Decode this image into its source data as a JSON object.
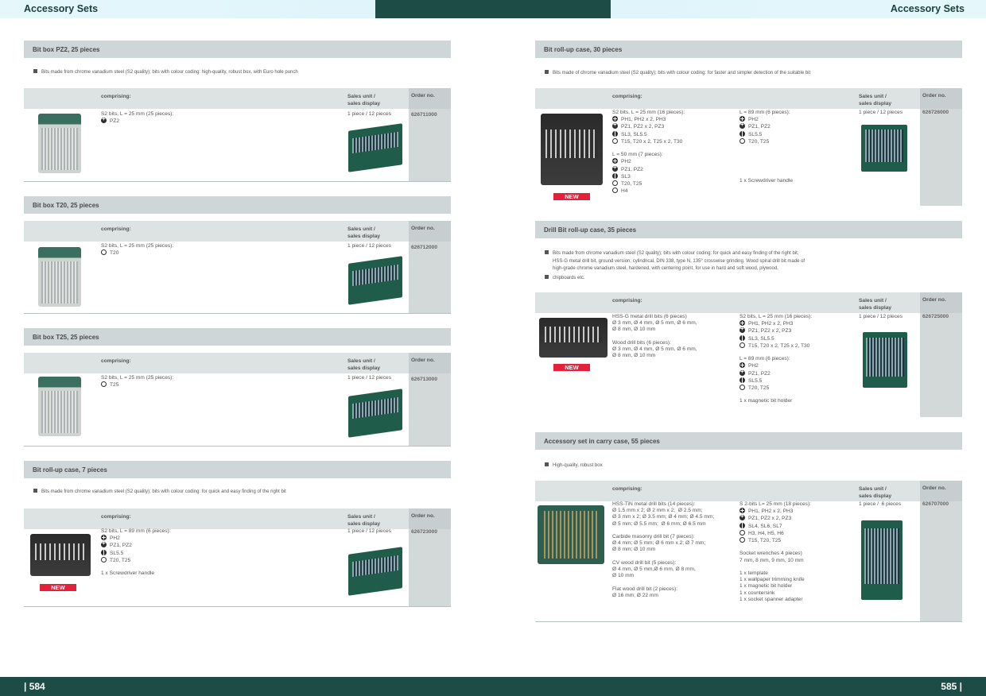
{
  "header": {
    "title_left": "Accessory Sets",
    "title_right": "Accessory Sets"
  },
  "footer": {
    "page_left": "| 584",
    "page_right": "585 |"
  },
  "table_labels": {
    "comprising": "comprising:",
    "sales_unit_1": "Sales unit /",
    "sales_unit_2": "sales display",
    "order_no": "Order no."
  },
  "new_label": "NEW",
  "sections": {
    "pz2": {
      "title": "Bit box PZ2, 25 pieces",
      "bullet": "Bits made from chrome vanadium steel (S2 quality); bits with colour coding: high-quality, robust box, with Euro hole punch",
      "col1": [
        {
          "t": "S2 bits, L = 25 mm (25 pieces):"
        },
        {
          "s": "pz",
          "t": "PZ2"
        }
      ],
      "sales": "1 piece / 12 pieces",
      "order": "626711000"
    },
    "t20": {
      "title": "Bit box T20, 25 pieces",
      "col1": [
        {
          "t": "S2 bits, L = 25 mm (25 pieces):"
        },
        {
          "s": "tx",
          "t": "T20"
        }
      ],
      "sales": "1 piece / 12 pieces",
      "order": "626712000"
    },
    "t25": {
      "title": "Bit box T25, 25 pieces",
      "col1": [
        {
          "t": "S2 bits, L = 25 mm (25 pieces):"
        },
        {
          "s": "tx",
          "t": "T25"
        }
      ],
      "sales": "1 piece / 12 pieces",
      "order": "626713000"
    },
    "roll7": {
      "title": "Bit roll-up case, 7 pieces",
      "bullet": "Bits made from chrome vanadium steel (S2 quality); bits with colour coding: for quick and easy finding of the right bit",
      "col1": [
        {
          "t": "S2 bits, L = 89 mm (6 pieces):"
        },
        {
          "s": "ph",
          "t": "PH2"
        },
        {
          "s": "pz",
          "t": "PZ1, PZ2"
        },
        {
          "s": "sl",
          "t": "SL5.5"
        },
        {
          "s": "tx",
          "t": "T20, T25"
        },
        {
          "t": ""
        },
        {
          "t": "1 x Screwdriver handle"
        }
      ],
      "sales": "1 piece / 12 pieces",
      "order": "626723000"
    },
    "roll30": {
      "title": "Bit roll-up case, 30 pieces",
      "bullet": "Bits made of chrome vanadium steel (S2 quality); bits with colour coding: for faster and simpler detection of the suitable bit",
      "col1": [
        {
          "t": "S2 bits, L = 25 mm (16 pieces):"
        },
        {
          "s": "ph",
          "t": "PH1, PH2 x 2, PH3"
        },
        {
          "s": "pz",
          "t": "PZ1, PZ2 x 2, PZ3"
        },
        {
          "s": "sl",
          "t": "SL3, SL5.5"
        },
        {
          "s": "tx",
          "t": "T15, T20 x 2, T25 x 2, T30"
        },
        {
          "t": ""
        },
        {
          "t": "L = 50 mm (7 pieces):"
        },
        {
          "s": "ph",
          "t": "PH2"
        },
        {
          "s": "pz",
          "t": "PZ1, PZ2"
        },
        {
          "s": "sl",
          "t": "SL3"
        },
        {
          "s": "tx",
          "t": "T20, T25"
        },
        {
          "s": "tx",
          "t": "H4"
        }
      ],
      "col2": [
        {
          "t": "L = 89 mm (6 pieces):"
        },
        {
          "s": "ph",
          "t": "PH2"
        },
        {
          "s": "pz",
          "t": "PZ1, PZ2"
        },
        {
          "s": "sl",
          "t": "SL5.5"
        },
        {
          "s": "tx",
          "t": "T20, T25"
        },
        {
          "t": ""
        },
        {
          "t": ""
        },
        {
          "t": ""
        },
        {
          "t": ""
        },
        {
          "t": ""
        },
        {
          "t": "1 x Screwdriver handle"
        }
      ],
      "sales": "1 piece / 12 pieces",
      "order": "626726000"
    },
    "drill35": {
      "title": "Drill Bit roll-up case, 35 pieces",
      "bullet_lines": [
        "Bits made from chrome vanadium steel (S2 quality); bits with colour coding: for quick and easy finding of the right bit;",
        "HSS-G metal drill bit, ground version, cylindrical, DIN 338, type N, 135° crosswise grinding. Wood spiral drill bit made of",
        "high-grade chrome vanadium steel, hardened, with centering point, for use in hard and soft wood, plywood,"
      ],
      "bullet2": "chipboards etc.",
      "col1": [
        {
          "t": "HSS-G metal drill bits (6 pieces)"
        },
        {
          "t": "Ø 3 mm, Ø 4 mm, Ø 5 mm, Ø 6 mm,"
        },
        {
          "t": "Ø 8 mm, Ø 10 mm"
        },
        {
          "t": ""
        },
        {
          "t": "Wood drill bits (6 pieces):"
        },
        {
          "t": "Ø 3 mm, Ø 4 mm, Ø 5 mm, Ø 6 mm,"
        },
        {
          "t": "Ø 8 mm, Ø 10 mm"
        }
      ],
      "col2": [
        {
          "t": "S2 bits, L = 25 mm (16 pieces):"
        },
        {
          "s": "ph",
          "t": "PH1, PH2 x 2, PH3"
        },
        {
          "s": "pz",
          "t": "PZ1, PZ2 x 2, PZ3"
        },
        {
          "s": "sl",
          "t": "SL3, SL5.5"
        },
        {
          "s": "tx",
          "t": "T15, T20 x 2, T25 x 2, T30"
        },
        {
          "t": ""
        },
        {
          "t": "L = 89 mm (6 pieces):"
        },
        {
          "s": "ph",
          "t": "PH2"
        },
        {
          "s": "pz",
          "t": "PZ1, PZ2"
        },
        {
          "s": "sl",
          "t": "SL5.5"
        },
        {
          "s": "tx",
          "t": "T20, T25"
        },
        {
          "t": ""
        },
        {
          "t": "1 x magnetic bit holder"
        }
      ],
      "sales": "1 piece / 12 pieces",
      "order": "626725000"
    },
    "carry55": {
      "title": "Accessory set in carry case, 55 pieces",
      "bullet": "High-quality, robust box",
      "col1": [
        {
          "t": "HSS-TiN metal drill bits (14 pieces):"
        },
        {
          "t": "Ø 1.5 mm x 2; Ø 2 mm x 2;  Ø 2.5 mm;"
        },
        {
          "t": "Ø 3 mm x 2; Ø 3.5 mm; Ø 4 mm; Ø 4.5 mm;"
        },
        {
          "t": "Ø 5 mm; Ø 5.5 mm;  Ø 6 mm; Ø 6.5 mm"
        },
        {
          "t": ""
        },
        {
          "t": "Carbide masonry drill bit (7 pieces):"
        },
        {
          "t": "Ø 4 mm; Ø 5 mm; Ø 6 mm x 2; Ø 7 mm;"
        },
        {
          "t": "Ø 8 mm; Ø 10 mm"
        },
        {
          "t": ""
        },
        {
          "t": "CV wood drill bit (5 pieces):"
        },
        {
          "t": "Ø 4 mm, Ø 5 mm,Ø 6 mm, Ø 8 mm,"
        },
        {
          "t": "Ø 10 mm"
        },
        {
          "t": ""
        },
        {
          "t": "Flat wood drill bit (2 pieces):"
        },
        {
          "t": "Ø 16 mm; Ø 22 mm"
        }
      ],
      "col2": [
        {
          "t": "S 2-bits L= 25 mm (18 pieces):"
        },
        {
          "s": "ph",
          "t": "PH1, PH2 x 2, PH3"
        },
        {
          "s": "pz",
          "t": "PZ1, PZ2 x 2, PZ3"
        },
        {
          "s": "sl",
          "t": "SL4, SL6, SL7"
        },
        {
          "s": "tx",
          "t": "H3, H4, H5, H6"
        },
        {
          "s": "tx",
          "t": "T15, T20, T25"
        },
        {
          "t": ""
        },
        {
          "t": "Socket wrenches 4 pieces)"
        },
        {
          "t": "7 mm, 8 mm, 9 mm, 10 mm"
        },
        {
          "t": ""
        },
        {
          "t": "1 x template"
        },
        {
          "t": "1 x wallpaper trimming knife"
        },
        {
          "t": "1 x magnetic bit holder"
        },
        {
          "t": "1 x countersink"
        },
        {
          "t": "1 x socket spanner adapter"
        }
      ],
      "sales": "1 piece /  6 pieces",
      "order": "626707000"
    }
  }
}
